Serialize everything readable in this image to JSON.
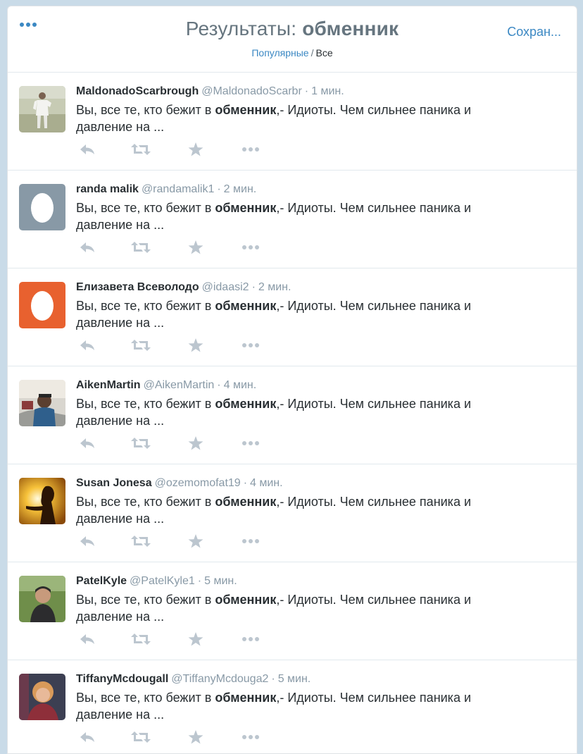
{
  "header": {
    "title_prefix": "Результаты:",
    "title_query": "обменник",
    "save_label": "Сохран...",
    "filter_popular": "Популярные",
    "filter_sep": "/",
    "filter_all": "Все"
  },
  "tweet_text": {
    "before": "Вы, все те, кто бежит в ",
    "bold": "обменник",
    "after": ",- Идиоты. Чем сильнее паника и",
    "line2": "давление на ..."
  },
  "tweets": [
    {
      "name": "MaldonadoScarbrough",
      "handle": "@MaldonadoScarbr",
      "dot": "·",
      "time": "1 мин."
    },
    {
      "name": "randa malik",
      "handle": "@randamalik1",
      "dot": "·",
      "time": "2 мин."
    },
    {
      "name": "Елизавета Всеволодо",
      "handle": "@idaasi2",
      "dot": "·",
      "time": "2 мин."
    },
    {
      "name": "AikenMartin",
      "handle": "@AikenMartin",
      "dot": "·",
      "time": "4 мин."
    },
    {
      "name": "Susan Jonesa",
      "handle": "@ozemomofat19",
      "dot": "·",
      "time": "4 мин."
    },
    {
      "name": "PatelKyle",
      "handle": "@PatelKyle1",
      "dot": "·",
      "time": "5 мин."
    },
    {
      "name": "TiffanyMcdougall",
      "handle": "@TiffanyMcdouga2",
      "dot": "·",
      "time": "5 мин."
    }
  ],
  "colors": {
    "accent": "#3b88c3",
    "egg_gray_bg": "#8899a6",
    "egg_orange_bg": "#e8612f",
    "icon_gray": "#bcc6cf"
  },
  "icons": {
    "menu": "more-dots-icon",
    "reply": "reply-icon",
    "retweet": "retweet-icon",
    "favorite": "star-icon",
    "more": "ellipsis-icon"
  }
}
